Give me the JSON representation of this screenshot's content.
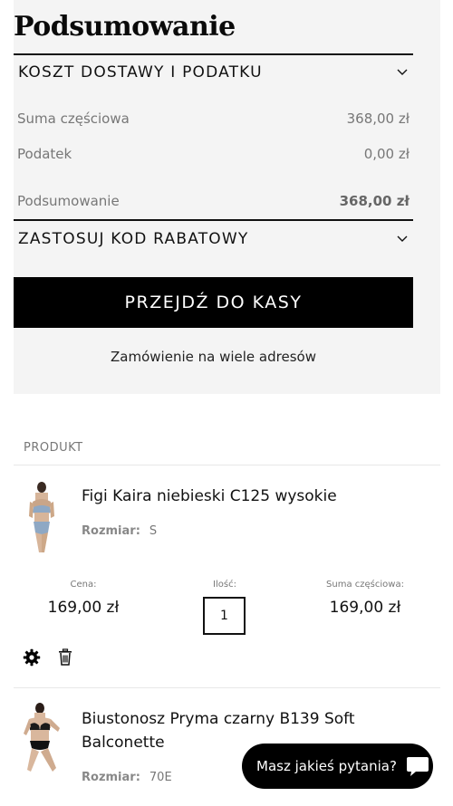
{
  "summary": {
    "title": "Podsumowanie",
    "shipping_section": "KOSZT DOSTAWY I PODATKU",
    "subtotal_label": "Suma częściowa",
    "subtotal_value": "368,00 zł",
    "tax_label": "Podatek",
    "tax_value": "0,00 zł",
    "total_label": "Podsumowanie",
    "total_value": "368,00 zł",
    "discount_section": "ZASTOSUJ KOD RABATOWY",
    "checkout_label": "PRZEJDŹ DO KASY",
    "multi_address_label": "Zamówienie na wiele adresów"
  },
  "cart": {
    "column_header": "PRODUKT",
    "items": [
      {
        "name": "Figi Kaira niebieski C125 wysokie",
        "size_label": "Rozmiar:",
        "size_value": "S",
        "price_label": "Cena:",
        "price_value": "169,00 zł",
        "qty_label": "Ilość:",
        "qty_value": "1",
        "subtotal_label": "Suma częściowa:",
        "subtotal_value": "169,00 zł"
      },
      {
        "name": "Biustonosz Pryma czarny B139 Soft Balconette",
        "size_label": "Rozmiar:",
        "size_value": "70E"
      }
    ]
  },
  "chat": {
    "label": "Masz jakieś pytania?"
  },
  "icons": {
    "chevron": "chevron-down-icon",
    "settings": "gear-icon",
    "delete": "trash-icon",
    "chat": "chat-bubble-icon"
  }
}
